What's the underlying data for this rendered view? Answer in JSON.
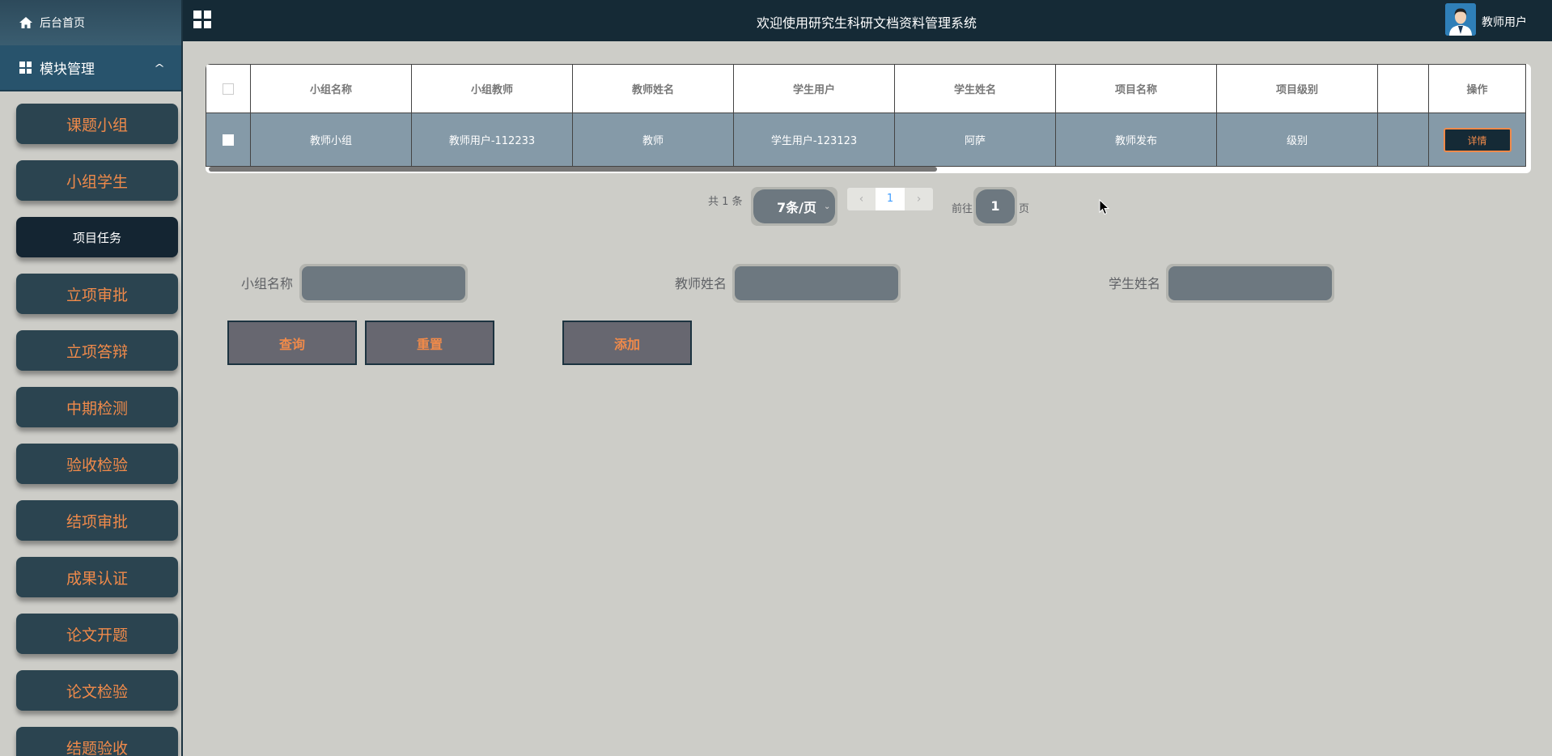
{
  "sidebar": {
    "home_label": "后台首页",
    "module_label": "模块管理",
    "items": [
      {
        "label": "课题小组"
      },
      {
        "label": "小组学生"
      },
      {
        "label": "项目任务"
      },
      {
        "label": "立项审批"
      },
      {
        "label": "立项答辩"
      },
      {
        "label": "中期检测"
      },
      {
        "label": "验收检验"
      },
      {
        "label": "结项审批"
      },
      {
        "label": "成果认证"
      },
      {
        "label": "论文开题"
      },
      {
        "label": "论文检验"
      },
      {
        "label": "结题验收"
      }
    ],
    "active_index": 2
  },
  "header": {
    "title": "欢迎使用研究生科研文档资料管理系统",
    "user_name": "教师用户"
  },
  "table": {
    "columns": [
      "小组名称",
      "小组教师",
      "教师姓名",
      "学生用户",
      "学生姓名",
      "项目名称",
      "项目级别",
      "",
      "操作"
    ],
    "rows": [
      {
        "cells": [
          "教师小组",
          "教师用户-112233",
          "教师",
          "学生用户-123123",
          "阿萨",
          "教师发布",
          "级别",
          ""
        ],
        "action": "详情"
      }
    ]
  },
  "pagination": {
    "total_text": "共 1 条",
    "page_size": "7条/页",
    "current_page": "1",
    "goto_label": "前往",
    "goto_value": "1",
    "page_suffix": "页"
  },
  "search": {
    "group_name_label": "小组名称",
    "teacher_name_label": "教师姓名",
    "student_name_label": "学生姓名",
    "query_button": "查询",
    "reset_button": "重置",
    "add_button": "添加"
  },
  "colors": {
    "sidebar_item_bg": "#2b4450",
    "accent_orange": "#f08a4a",
    "topbar_bg": "#152a36",
    "row_bg": "#859aa8"
  }
}
